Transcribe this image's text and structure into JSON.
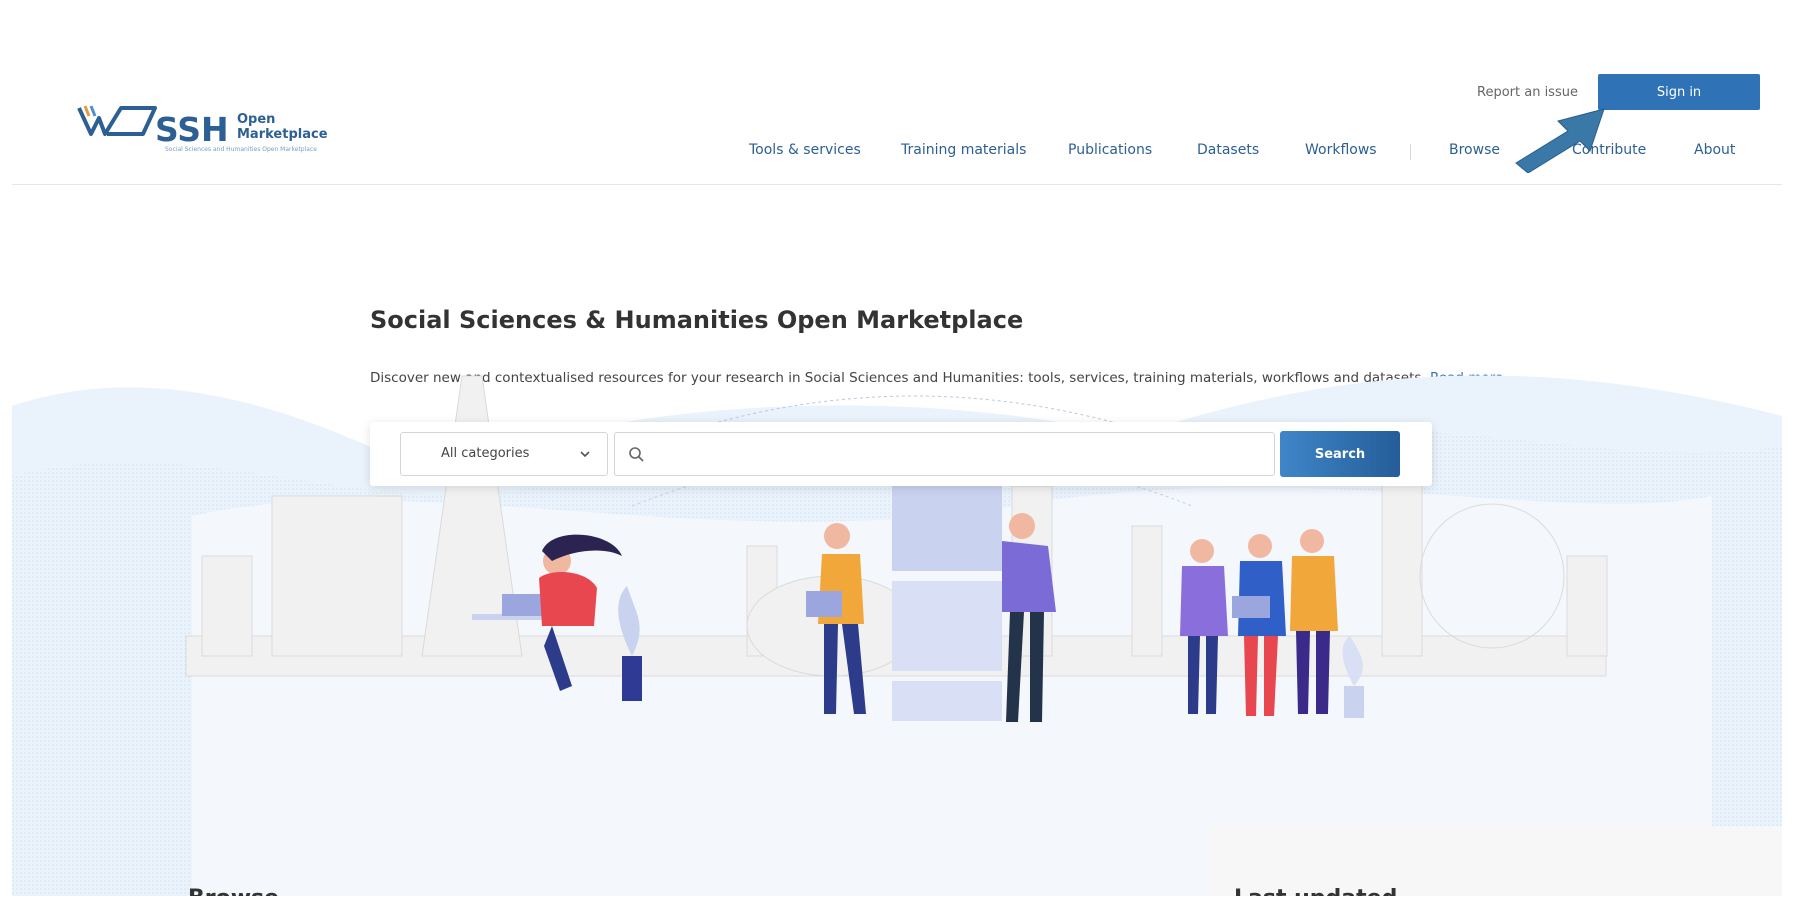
{
  "header": {
    "logo": {
      "word": "SSH",
      "line1": "Open",
      "line2": "Marketplace",
      "tagline": "Social Sciences and Humanities Open Marketplace"
    },
    "report_link": "Report an issue",
    "signin_label": "Sign in",
    "nav": [
      {
        "label": "Tools & services"
      },
      {
        "label": "Training materials"
      },
      {
        "label": "Publications"
      },
      {
        "label": "Datasets"
      },
      {
        "label": "Workflows"
      },
      {
        "label": "Browse"
      },
      {
        "label": "Contribute"
      },
      {
        "label": "About"
      }
    ]
  },
  "hero": {
    "title": "Social Sciences & Humanities Open Marketplace",
    "description": "Discover new and contextualised resources for your research in Social Sciences and Humanities: tools, services, training materials, workflows and datasets.",
    "read_more": "Read more…"
  },
  "search": {
    "category_selected": "All categories",
    "input_value": "",
    "button_label": "Search"
  },
  "sections": {
    "browse_title": "Browse",
    "last_updated_title": "Last updated"
  },
  "colors": {
    "brand": "#2c5f94",
    "accent": "#2f73b6",
    "annotation_arrow": "#3a78a8"
  },
  "icons": [
    "logo-mark-icon",
    "chevron-down-icon",
    "search-icon",
    "annotation-arrow-icon"
  ]
}
